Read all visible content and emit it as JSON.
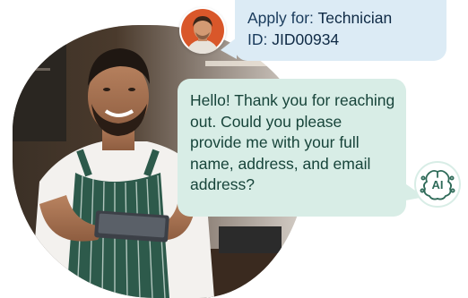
{
  "applicant_message": {
    "apply_label": "Apply for:",
    "job_title": "Technician",
    "id_label": "ID:",
    "job_id": "JID00934"
  },
  "ai_message": {
    "text": "Hello! Thank you for reaching out. Could you please provide me with your full name, address, and email address?"
  },
  "ai_badge": {
    "label": "AI",
    "icon": "ai-brain-icon"
  },
  "colors": {
    "applicant_bubble": "#dcebf5",
    "ai_bubble": "#d8ede6",
    "ai_text": "#17443a",
    "applicant_text": "#1a3b5c"
  }
}
